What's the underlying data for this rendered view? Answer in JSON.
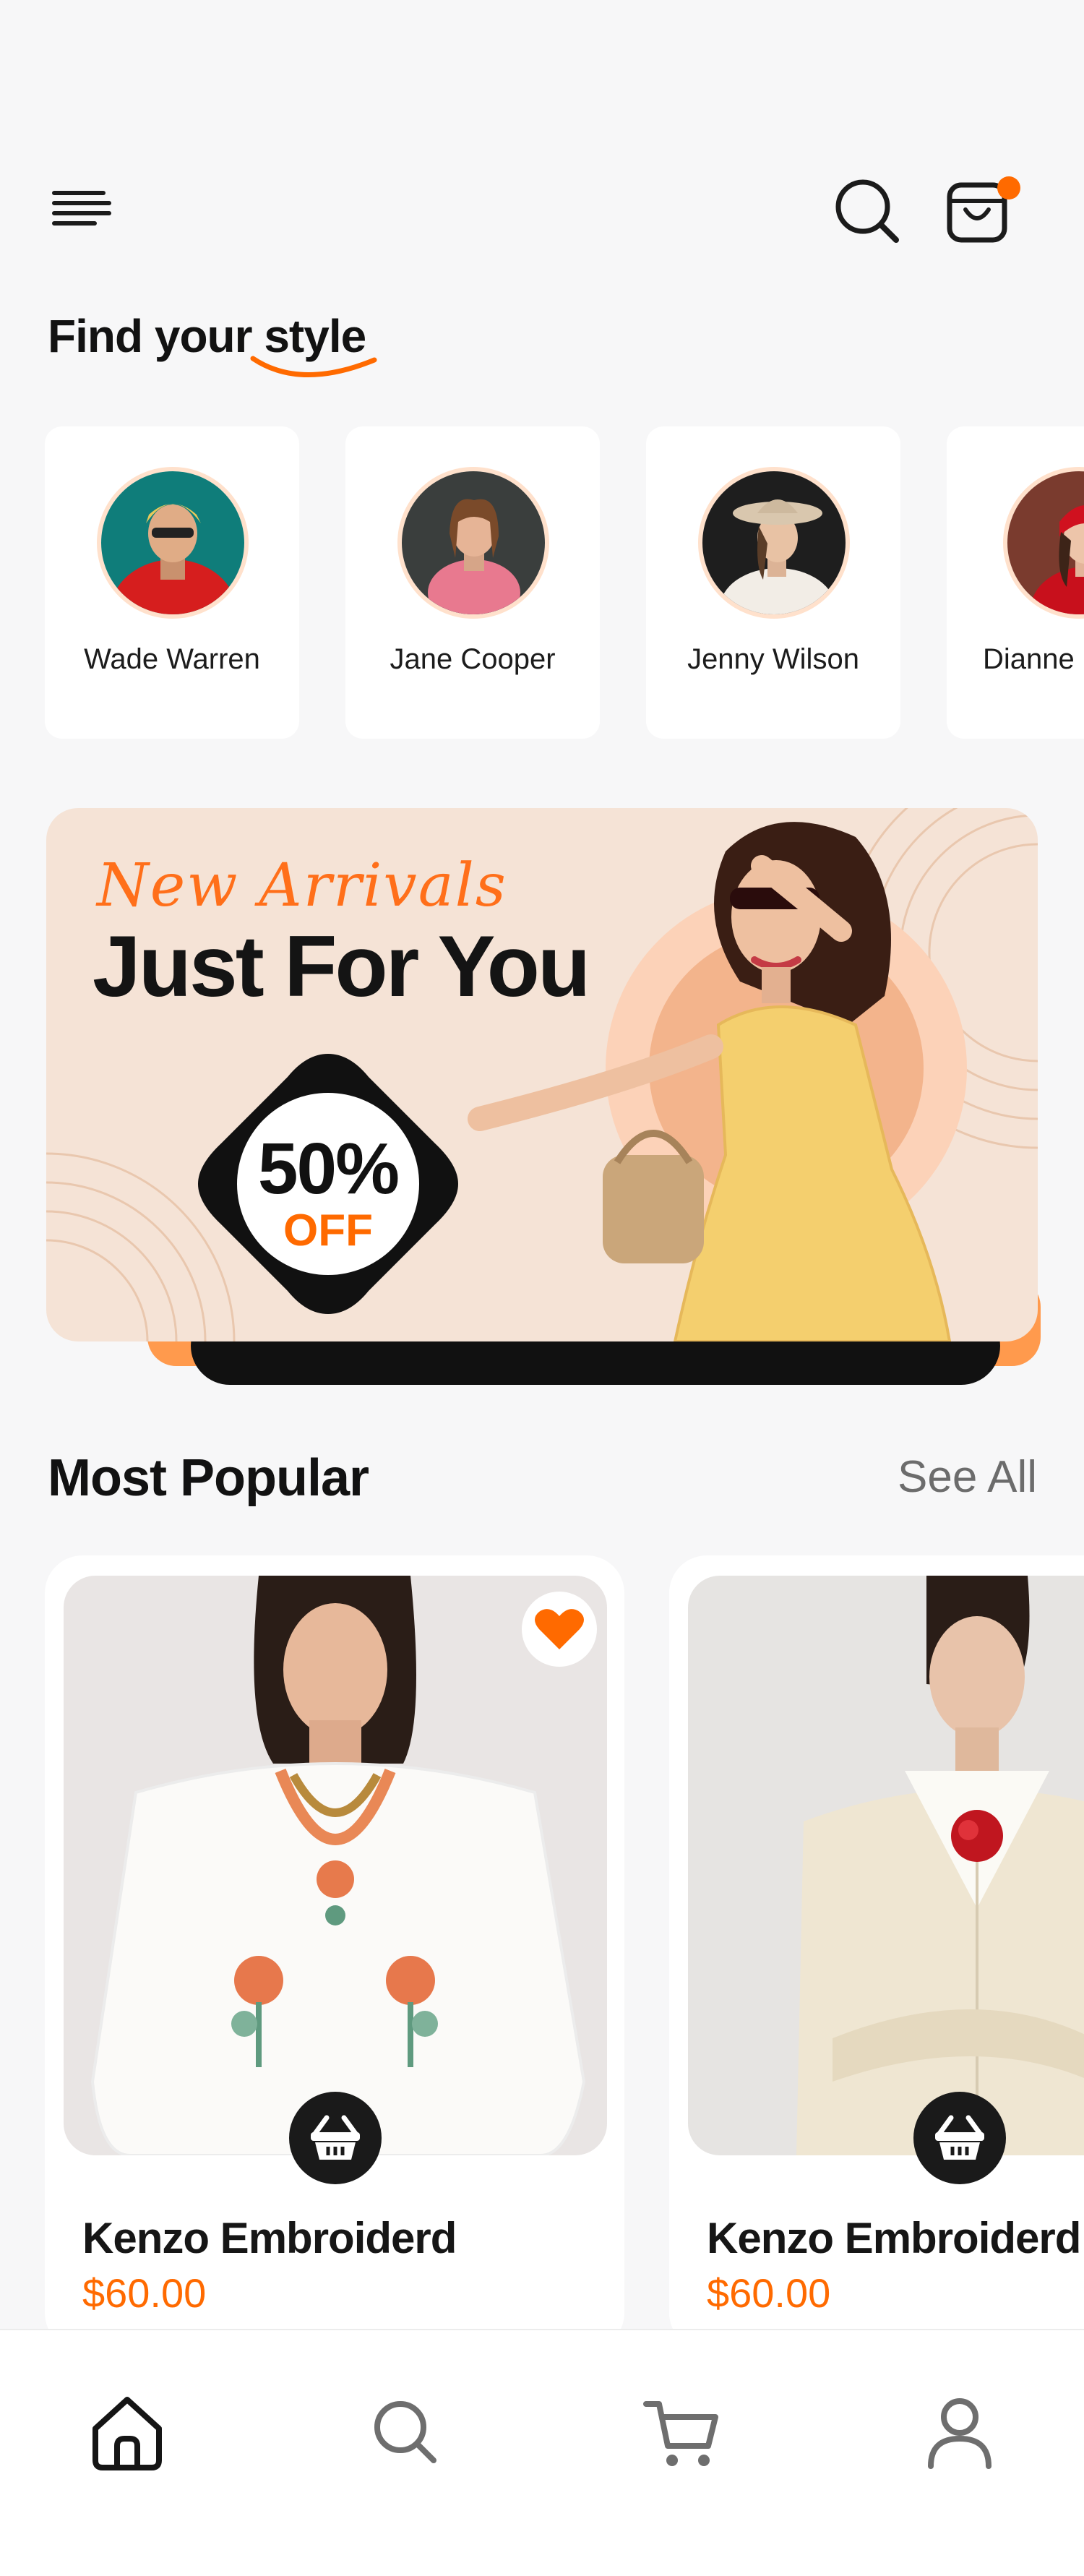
{
  "header": {
    "menu_icon": "menu-icon",
    "search_icon": "search-icon",
    "bag_icon": "shopping-bag-icon",
    "notification_color": "#ff6a00"
  },
  "find_style": {
    "title": "Find your style"
  },
  "stylists": [
    {
      "name": "Wade Warren",
      "avatar_bg": "#0f7d7a",
      "shirt_color": "#d61e1e"
    },
    {
      "name": "Jane Cooper",
      "avatar_bg": "#3a3e3d",
      "shirt_color": "#e8798f"
    },
    {
      "name": "Jenny Wilson",
      "avatar_bg": "#1e1e1e",
      "shirt_color": "#f2ede6"
    },
    {
      "name": "Dianne Russell",
      "avatar_bg": "#7a3b2e",
      "shirt_color": "#c8101c"
    }
  ],
  "banner": {
    "script_text": "New Arrivals",
    "headline": "Just For You",
    "discount_value": "50%",
    "discount_label": "OFF",
    "accent": "#ff6a00",
    "bg": "#f5e3d6"
  },
  "most_popular": {
    "title": "Most Popular",
    "see_all": "See All",
    "products": [
      {
        "name": "Kenzo Embroiderd",
        "price": "$60.00",
        "favorited": true,
        "img_bg": "#e9e5e4"
      },
      {
        "name": "Kenzo Embroiderd",
        "price": "$60.00",
        "favorited": false,
        "img_bg": "#e6e4e2"
      }
    ]
  },
  "bottom_nav": {
    "items": [
      "home-icon",
      "search-icon",
      "cart-icon",
      "profile-icon"
    ],
    "active": "home-icon"
  }
}
